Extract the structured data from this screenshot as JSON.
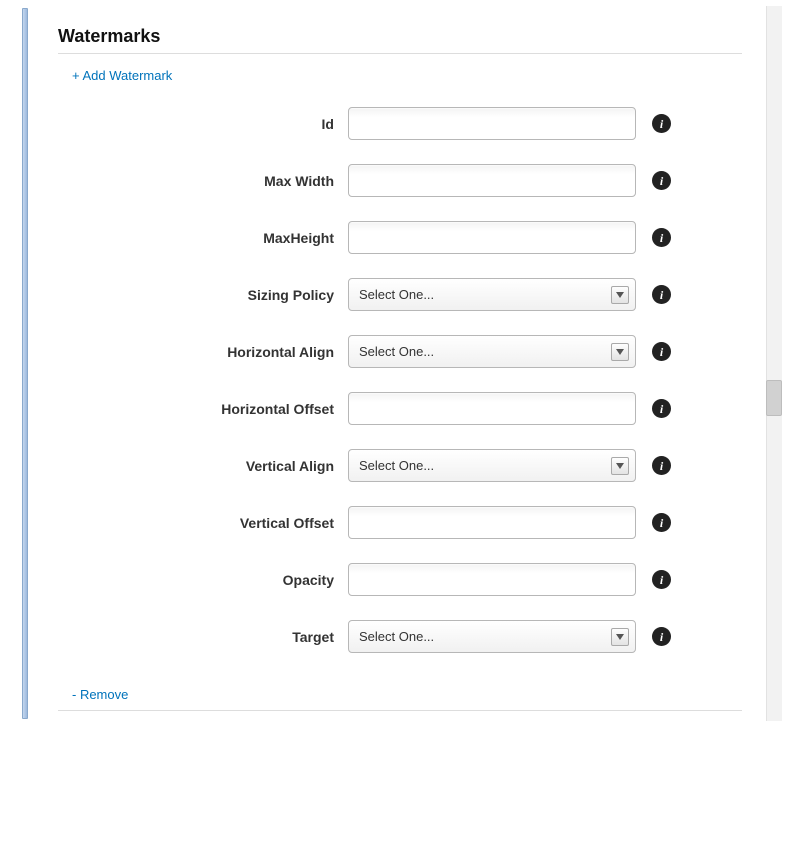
{
  "section": {
    "title": "Watermarks"
  },
  "actions": {
    "add_label": "+ Add Watermark",
    "remove_label": "- Remove"
  },
  "select_placeholder": "Select One...",
  "fields": [
    {
      "key": "id",
      "label": "Id",
      "type": "text",
      "value": ""
    },
    {
      "key": "maxWidth",
      "label": "Max Width",
      "type": "text",
      "value": ""
    },
    {
      "key": "maxHeight",
      "label": "MaxHeight",
      "type": "text",
      "value": ""
    },
    {
      "key": "sizingPolicy",
      "label": "Sizing Policy",
      "type": "select",
      "value": ""
    },
    {
      "key": "horizontalAlign",
      "label": "Horizontal Align",
      "type": "select",
      "value": ""
    },
    {
      "key": "horizontalOffset",
      "label": "Horizontal Offset",
      "type": "text",
      "value": ""
    },
    {
      "key": "verticalAlign",
      "label": "Vertical Align",
      "type": "select",
      "value": ""
    },
    {
      "key": "verticalOffset",
      "label": "Vertical Offset",
      "type": "text",
      "value": ""
    },
    {
      "key": "opacity",
      "label": "Opacity",
      "type": "text",
      "value": ""
    },
    {
      "key": "target",
      "label": "Target",
      "type": "select",
      "value": ""
    }
  ]
}
